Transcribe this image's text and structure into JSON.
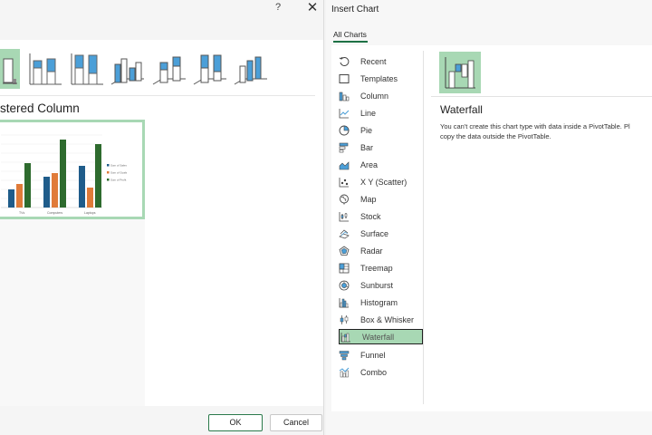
{
  "left_dialog": {
    "help_label": "?",
    "close_label": "✕",
    "variant_title": "stered Column",
    "preview_legend": [
      "Sum of Sales",
      "Sum of Goals",
      "Sum of Profit"
    ],
    "preview_categories": [
      "TVs",
      "Computers",
      "Laptops"
    ],
    "ok_label": "OK",
    "cancel_label": "Cancel"
  },
  "right_dialog": {
    "title": "Insert Chart",
    "tab_all": "All Charts",
    "chart_types": [
      {
        "label": "Recent",
        "icon": "recent-icon"
      },
      {
        "label": "Templates",
        "icon": "templates-icon"
      },
      {
        "label": "Column",
        "icon": "column-icon"
      },
      {
        "label": "Line",
        "icon": "line-icon"
      },
      {
        "label": "Pie",
        "icon": "pie-icon"
      },
      {
        "label": "Bar",
        "icon": "bar-icon"
      },
      {
        "label": "Area",
        "icon": "area-icon"
      },
      {
        "label": "X Y (Scatter)",
        "icon": "scatter-icon"
      },
      {
        "label": "Map",
        "icon": "map-icon"
      },
      {
        "label": "Stock",
        "icon": "stock-icon"
      },
      {
        "label": "Surface",
        "icon": "surface-icon"
      },
      {
        "label": "Radar",
        "icon": "radar-icon"
      },
      {
        "label": "Treemap",
        "icon": "treemap-icon"
      },
      {
        "label": "Sunburst",
        "icon": "sunburst-icon"
      },
      {
        "label": "Histogram",
        "icon": "histogram-icon"
      },
      {
        "label": "Box & Whisker",
        "icon": "box-whisker-icon"
      },
      {
        "label": "Waterfall",
        "icon": "waterfall-icon"
      },
      {
        "label": "Funnel",
        "icon": "funnel-icon"
      },
      {
        "label": "Combo",
        "icon": "combo-icon"
      }
    ],
    "selected_type": "Waterfall",
    "detail_title": "Waterfall",
    "detail_desc_line1": "You can't create this chart type with data inside a PivotTable. Pl",
    "detail_desc_line2": "copy the data outside the PivotTable."
  },
  "colors": {
    "accent_green": "#1e7145",
    "selection_bg": "#a8d8b4",
    "series_blue": "#1f5c8a",
    "series_orange": "#e07b39",
    "series_green": "#2e6b2e",
    "icon_blue": "#4b9fd8"
  }
}
